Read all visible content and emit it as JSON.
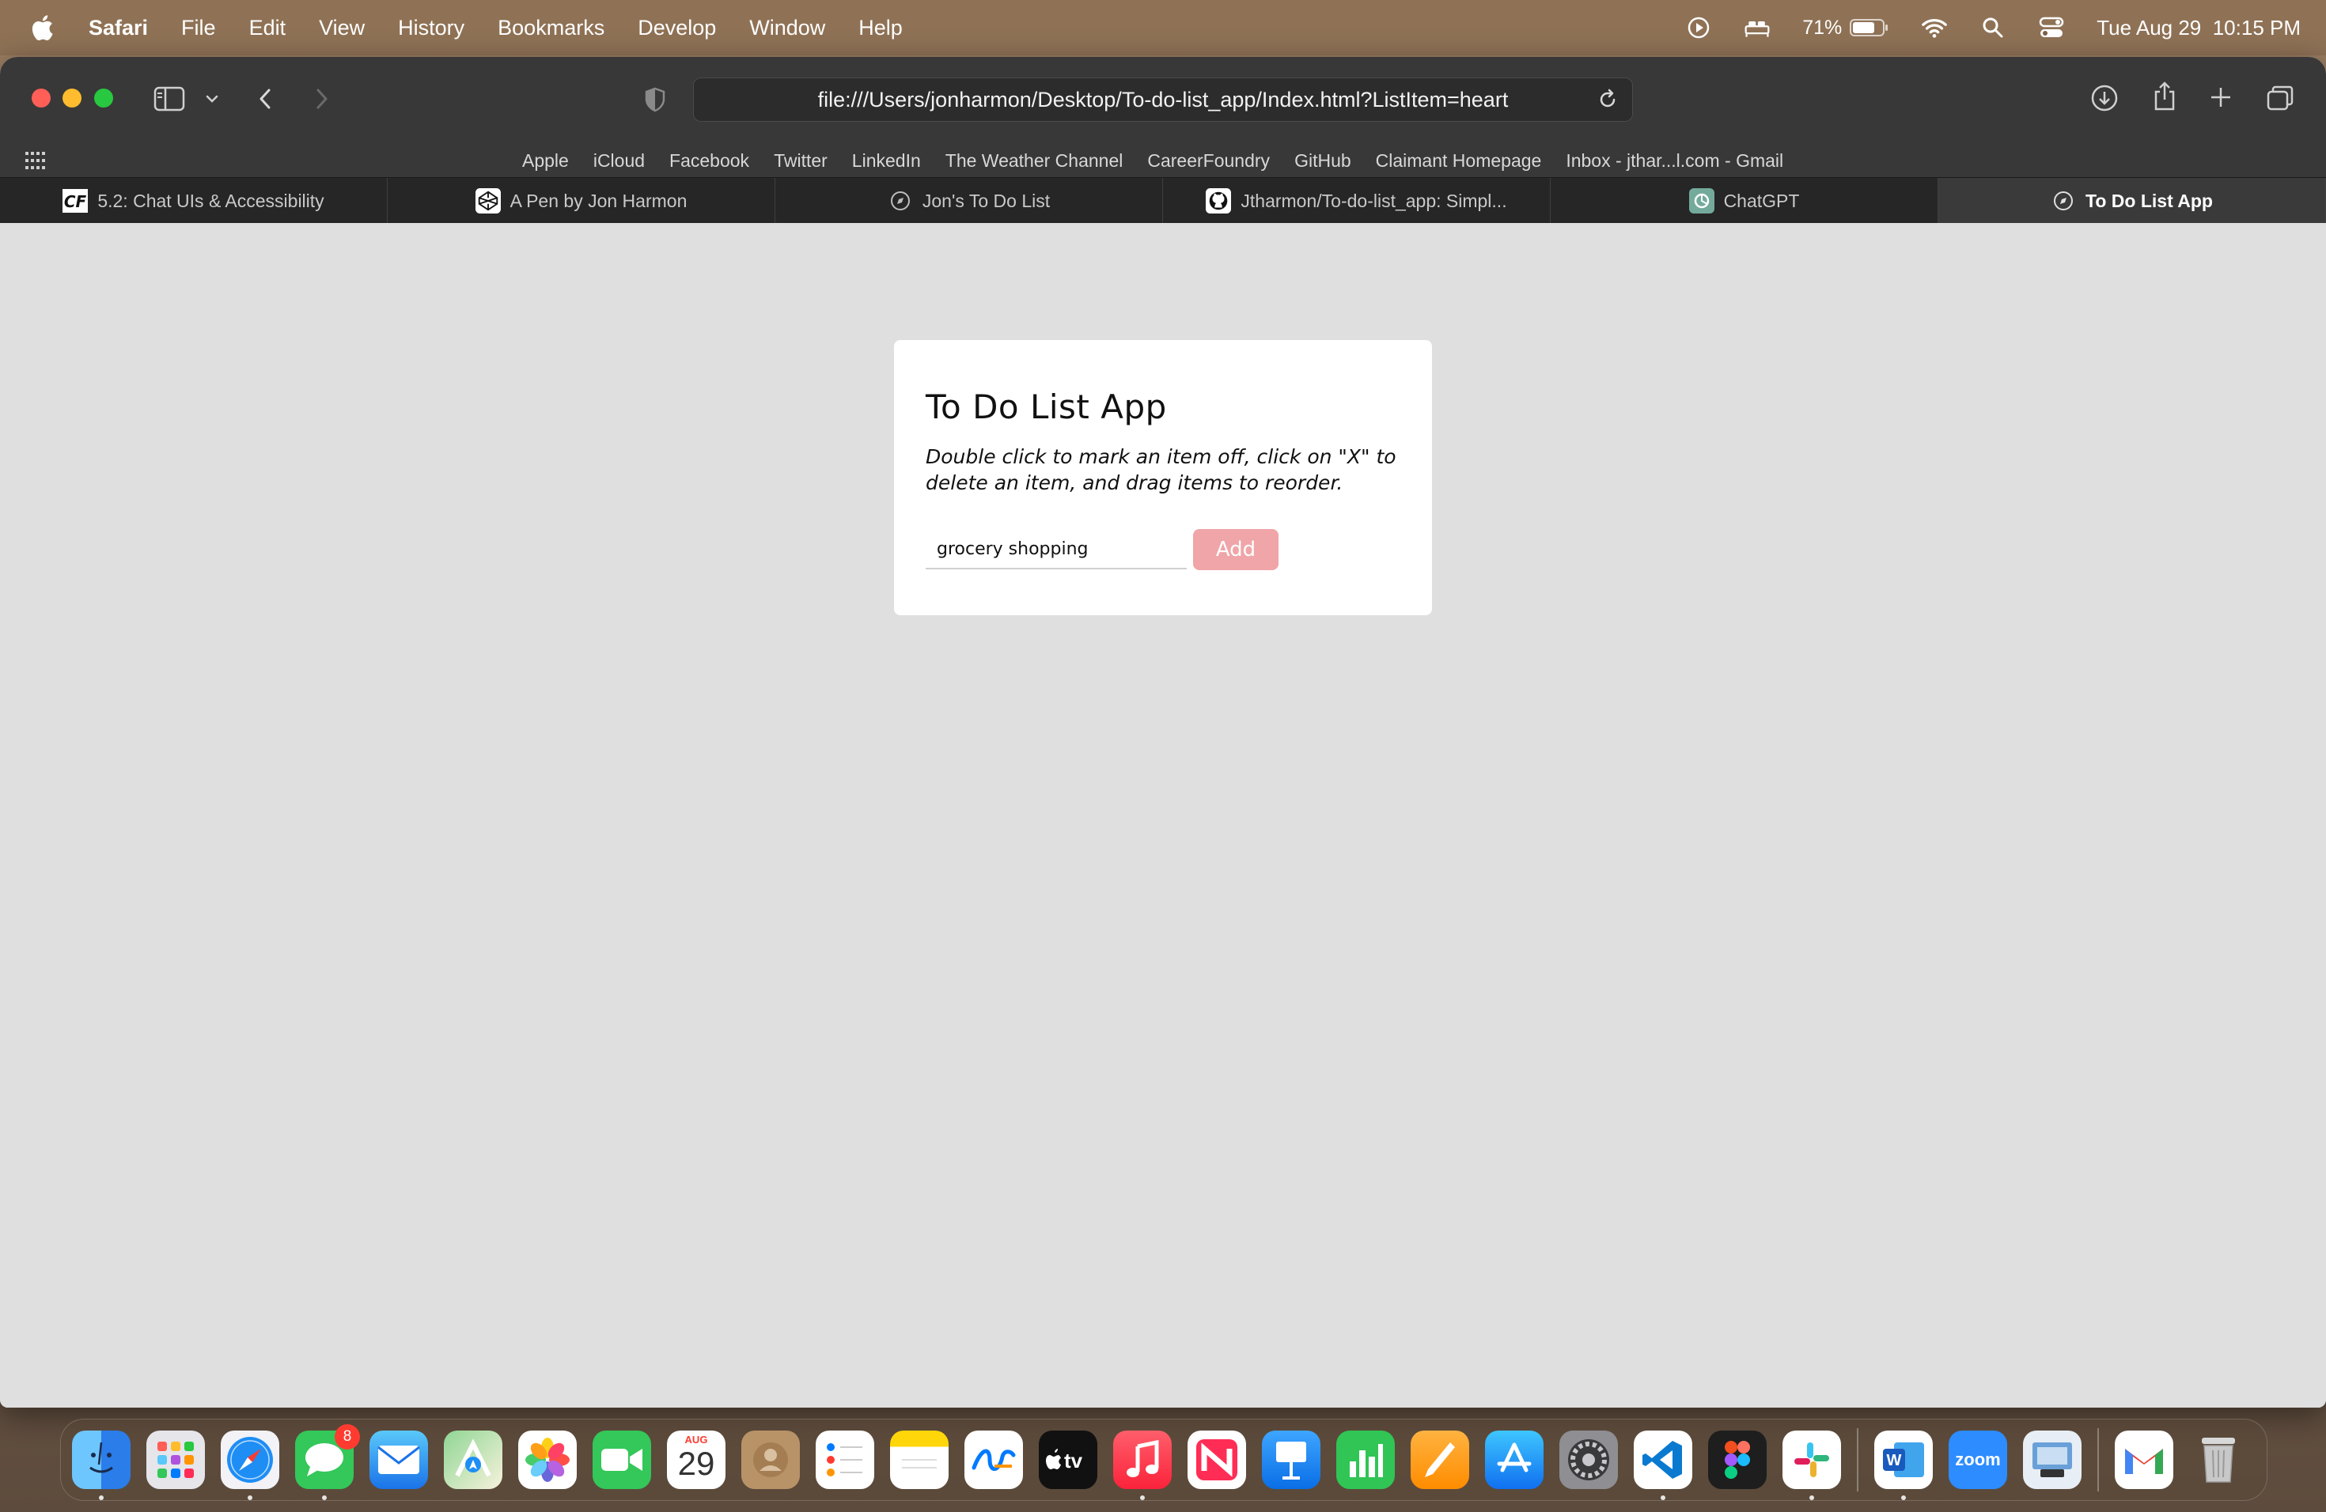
{
  "menubar": {
    "app_name": "Safari",
    "items": [
      "File",
      "Edit",
      "View",
      "History",
      "Bookmarks",
      "Develop",
      "Window",
      "Help"
    ],
    "battery": "71%",
    "datetime": "Tue Aug 29  10:15 PM"
  },
  "browser": {
    "url": "file:///Users/jonharmon/Desktop/To-do-list_app/Index.html?ListItem=heart",
    "favorites": [
      "Apple",
      "iCloud",
      "Facebook",
      "Twitter",
      "LinkedIn",
      "The Weather Channel",
      "CareerFoundry",
      "GitHub",
      "Claimant Homepage",
      "Inbox - jthar...l.com - Gmail"
    ],
    "tabs": [
      {
        "label": "5.2: Chat UIs & Accessibility",
        "icon": "careerfoundry-icon"
      },
      {
        "label": "A Pen by Jon Harmon",
        "icon": "codepen-icon"
      },
      {
        "label": "Jon's To Do List",
        "icon": "compass-icon"
      },
      {
        "label": "Jtharmon/To-do-list_app: Simpl...",
        "icon": "github-icon"
      },
      {
        "label": "ChatGPT",
        "icon": "chatgpt-icon"
      },
      {
        "label": "To Do List App",
        "icon": "compass-icon",
        "active": true
      }
    ]
  },
  "app": {
    "title": "To Do List App",
    "instructions": "Double click to mark an item off, click on \"X\" to delete an item, and drag items to reorder.",
    "input_value": "grocery shopping",
    "add_label": "Add",
    "accent_color": "#f0a5a8"
  },
  "dock": {
    "messages_badge": "8",
    "calendar_month": "AUG",
    "calendar_day": "29",
    "zoom_label": "zoom"
  }
}
